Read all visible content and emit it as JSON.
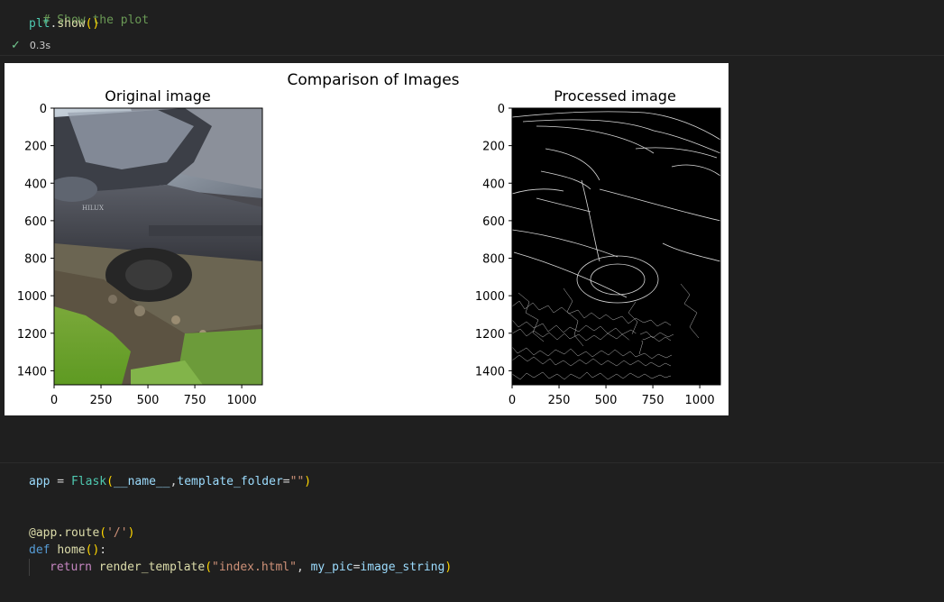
{
  "cell1": {
    "comment": "# Show the plot",
    "code": {
      "obj": "plt",
      "dot": ".",
      "method": "show",
      "parens": "()"
    },
    "status": {
      "time": "0.3s"
    }
  },
  "figure": {
    "suptitle": "Comparison of Images",
    "left_title": "Original image",
    "right_title": "Processed image",
    "y_ticks": [
      "0",
      "200",
      "400",
      "600",
      "800",
      "1000",
      "1200",
      "1400"
    ],
    "x_ticks": [
      "0",
      "250",
      "500",
      "750",
      "1000"
    ],
    "left_image_desc": "photo of grey Toyota Hilux pickup truck with front wheel in a muddy ditch and grass",
    "right_image_desc": "edge-detected (Canny) version of the truck photo, white edges on black",
    "embossed_text": "HILUX"
  },
  "cell2": {
    "line1": {
      "var": "app",
      "eq": " = ",
      "cls": "Flask",
      "p1": "(",
      "arg1": "__name__",
      "comma": ",",
      "kw": "template_folder",
      "eq2": "=",
      "str": "\"\"",
      "p2": ")"
    },
    "line2": {
      "deco": "@app.route",
      "p1": "(",
      "str": "'/'",
      "p2": ")"
    },
    "line3": {
      "kw": "def",
      "sp": " ",
      "fn": "home",
      "parens": "()",
      "colon": ":"
    },
    "line4": {
      "kw": "return",
      "sp": " ",
      "fn": "render_template",
      "p1": "(",
      "str": "\"index.html\"",
      "comma": ", ",
      "kw_arg": "my_pic",
      "eq": "=",
      "val": "image_string",
      "p2": ")"
    }
  }
}
